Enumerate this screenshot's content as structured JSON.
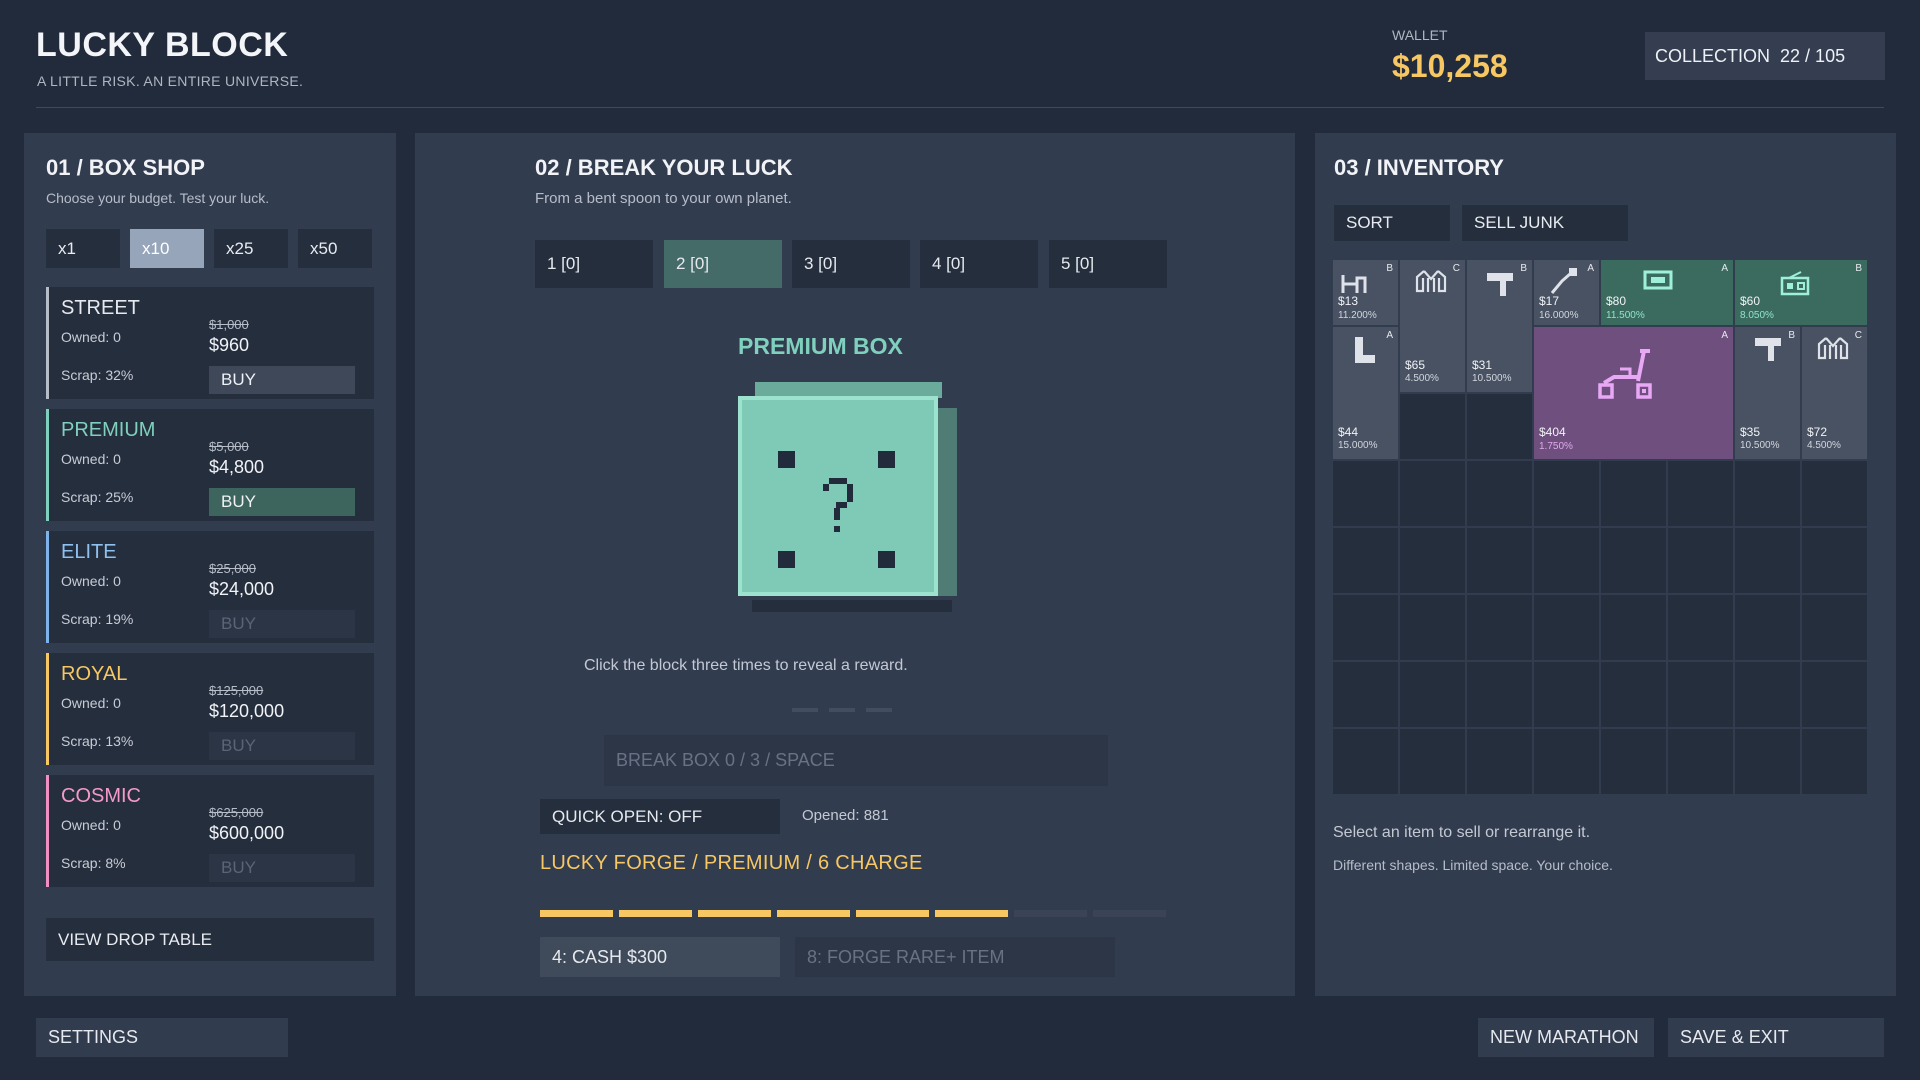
{
  "header": {
    "title": "LUCKY BLOCK",
    "tagline": "A LITTLE RISK. AN ENTIRE UNIVERSE.",
    "wallet_label": "WALLET",
    "wallet_amount": "$10,258",
    "collection_label": "COLLECTION",
    "collection_value": "22 / 105"
  },
  "shop": {
    "title": "01 / BOX SHOP",
    "subtitle": "Choose your budget. Test your luck.",
    "multipliers": [
      "x1",
      "x10",
      "x25",
      "x50"
    ],
    "selected_multiplier": "x10",
    "boxes": [
      {
        "name": "STREET",
        "owned": "Owned: 0",
        "scrap": "Scrap: 32%",
        "old_price": "$1,000",
        "price": "$960",
        "buy": "BUY",
        "color": "#b6bdc9",
        "name_color": "#e6e9ee",
        "state": "enabled"
      },
      {
        "name": "PREMIUM",
        "owned": "Owned: 0",
        "scrap": "Scrap: 25%",
        "old_price": "$5,000",
        "price": "$4,800",
        "buy": "BUY",
        "color": "#7fd0bd",
        "name_color": "#7fd0bd",
        "state": "selected"
      },
      {
        "name": "ELITE",
        "owned": "Owned: 0",
        "scrap": "Scrap: 19%",
        "old_price": "$25,000",
        "price": "$24,000",
        "buy": "BUY",
        "color": "#7fb2e8",
        "name_color": "#8ec0f0",
        "state": "disabled"
      },
      {
        "name": "ROYAL",
        "owned": "Owned: 0",
        "scrap": "Scrap: 13%",
        "old_price": "$125,000",
        "price": "$120,000",
        "buy": "BUY",
        "color": "#f6c762",
        "name_color": "#f6c762",
        "state": "disabled"
      },
      {
        "name": "COSMIC",
        "owned": "Owned: 0",
        "scrap": "Scrap: 8%",
        "old_price": "$625,000",
        "price": "$600,000",
        "buy": "BUY",
        "color": "#ef8fc2",
        "name_color": "#f49ac8",
        "state": "disabled"
      }
    ],
    "view_drop_table": "VIEW DROP TABLE"
  },
  "break": {
    "title": "02 / BREAK YOUR LUCK",
    "subtitle": "From a bent spoon to your own planet.",
    "slots": [
      "1  [0]",
      "2  [0]",
      "3  [0]",
      "4  [0]",
      "5  [0]"
    ],
    "selected_slot": 1,
    "box_name": "PREMIUM BOX",
    "box_color": "#7fd0bd",
    "hint": "Click the block three times to reveal a reward.",
    "break_button": "BREAK BOX  0 / 3  /  SPACE",
    "quick_open": "QUICK OPEN: OFF",
    "opened": "Opened: 881",
    "forge": "LUCKY FORGE / PREMIUM / 6 CHARGE",
    "forge_charge": 6,
    "forge_max": 8,
    "cash_reward": "4: CASH $300",
    "forge_reward": "8: FORGE RARE+ ITEM"
  },
  "inventory": {
    "title": "03 / INVENTORY",
    "sort": "SORT",
    "sell_junk": "SELL JUNK",
    "items": [
      {
        "icon": "chair-icon",
        "grade": "B",
        "value": "$13",
        "pct": "11.200%",
        "tint": "gray"
      },
      {
        "icon": "jacket-icon",
        "grade": "C",
        "value": "$65",
        "pct": "4.500%",
        "tint": "gray"
      },
      {
        "icon": "tshirt-icon",
        "grade": "B",
        "value": "$31",
        "pct": "10.500%",
        "tint": "gray"
      },
      {
        "icon": "bent-spoon-icon",
        "grade": "A",
        "value": "$17",
        "pct": "16.000%",
        "tint": "gray"
      },
      {
        "icon": "monitor-icon",
        "grade": "A",
        "value": "$80",
        "pct": "11.500%",
        "tint": "green"
      },
      {
        "icon": "radio-icon",
        "grade": "B",
        "value": "$60",
        "pct": "8.050%",
        "tint": "green"
      },
      {
        "icon": "boot-icon",
        "grade": "A",
        "value": "$44",
        "pct": "15.000%",
        "tint": "gray"
      },
      {
        "icon": "scooter-icon",
        "grade": "A",
        "value": "$404",
        "pct": "1.750%",
        "tint": "purple"
      },
      {
        "icon": "tshirt-icon",
        "grade": "B",
        "value": "$35",
        "pct": "10.500%",
        "tint": "gray"
      },
      {
        "icon": "jacket-icon",
        "grade": "C",
        "value": "$72",
        "pct": "4.500%",
        "tint": "gray"
      }
    ],
    "hint1": "Select an item to sell or rearrange it.",
    "hint2": "Different shapes. Limited space. Your choice."
  },
  "footer": {
    "settings": "SETTINGS",
    "new_marathon": "NEW MARATHON",
    "save_exit": "SAVE & EXIT"
  }
}
